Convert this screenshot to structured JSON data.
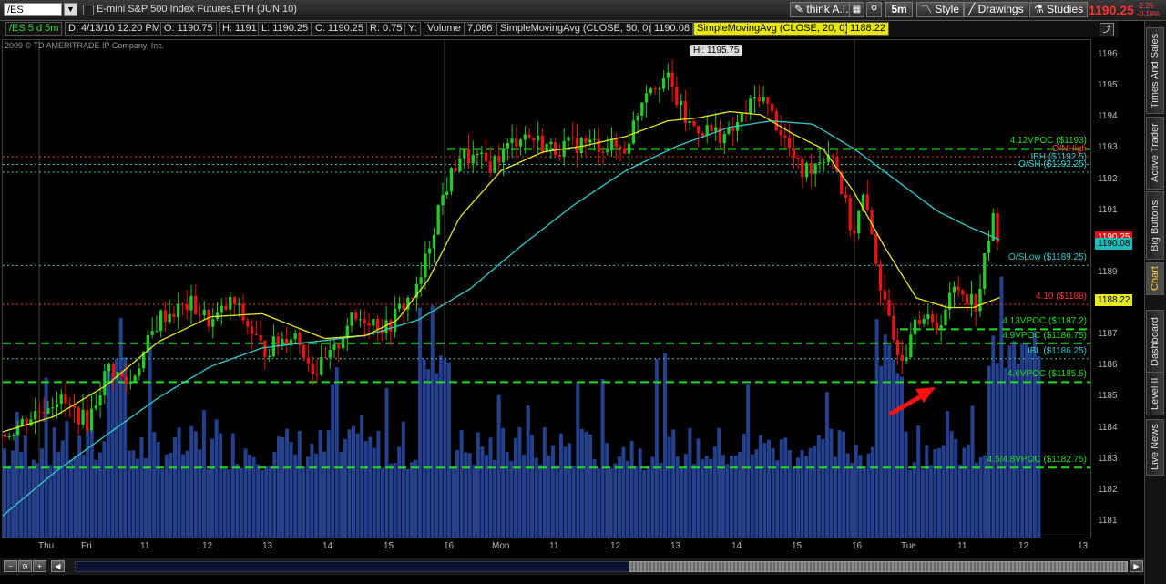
{
  "toolbar": {
    "symbol": "/ES",
    "description": "E-mini S&P 500 Index Futures,ETH (JUN 10)",
    "think_ai": "think A.I.",
    "timeframe": "5m",
    "style": "Style",
    "drawings": "Drawings",
    "studies": "Studies",
    "last_price": "1190.25",
    "change_abs": "-2.25",
    "change_pct": "-0.19%"
  },
  "infobar": {
    "title": "/ES 5 d 5m",
    "date": "D: 4/13/10 12:20 PM",
    "open": "O: 1190.75",
    "high": "H: 1191",
    "low": "L: 1190.25",
    "close": "C: 1190.25",
    "range": "R: 0.75",
    "y": "Y:",
    "volume_label": "Volume",
    "volume_value": "7,086",
    "sma50_label": "SimpleMovingAvg (CLOSE, 50, 0)",
    "sma50_value": "1190.08",
    "sma20_label": "SimpleMovingAvg (CLOSE, 20, 0)",
    "sma20_value": "1188.22"
  },
  "copyright": "2009 © TD AMERITRADE IP Company, Inc.",
  "chart_data": {
    "type": "candlestick",
    "title": "E-mini S&P 500 Index Futures,ETH (JUN 10)",
    "y_ticks": [
      "1196",
      "1195",
      "1194",
      "1193",
      "1192",
      "1191",
      "1190",
      "1189",
      "1188",
      "1187",
      "1186",
      "1185",
      "1184",
      "1183",
      "1182",
      "1181"
    ],
    "ylim": [
      1180.5,
      1196.5
    ],
    "x_ticks": [
      "Thu",
      "Fri",
      "11",
      "12",
      "13",
      "14",
      "15",
      "16",
      "Mon",
      "11",
      "12",
      "13",
      "14",
      "15",
      "16",
      "Tue",
      "11",
      "12",
      "13"
    ],
    "high_label": "Hi: 1195.75",
    "last_price_tag": "1190.25",
    "sma50_tag": "1190.08",
    "sma20_tag": "1188.22",
    "levels": [
      {
        "label": "4.12VPOC ($1193)",
        "price": 1193,
        "color": "#22dd22",
        "style": "dashed"
      },
      {
        "label": "O/NHigh",
        "price": 1192.75,
        "color": "#ff3333",
        "style": "dotted"
      },
      {
        "label": "IBH ($1192.5)",
        "price": 1192.5,
        "color": "#33cccc",
        "style": "dotted"
      },
      {
        "label": "O/SH ($1192.25)",
        "price": 1192.25,
        "color": "#33cccc",
        "style": "dotted"
      },
      {
        "label": "O/SLow ($1189.25)",
        "price": 1189.25,
        "color": "#33cccc",
        "style": "dotted"
      },
      {
        "label": "4.10 ($1188)",
        "price": 1188,
        "color": "#ff3333",
        "style": "dotted"
      },
      {
        "label": "4.13VPOC ($1187.2)",
        "price": 1187.2,
        "color": "#22dd22",
        "style": "dashed"
      },
      {
        "label": "4.9VPOC ($1186.75)",
        "price": 1186.75,
        "color": "#22dd22",
        "style": "dashed"
      },
      {
        "label": "IBL ($1186.25)",
        "price": 1186.25,
        "color": "#33cccc",
        "style": "dotted"
      },
      {
        "label": "4.6VPOC ($1185.5)",
        "price": 1185.5,
        "color": "#22dd22",
        "style": "dashed"
      },
      {
        "label": "4.5/4.8VPOC ($1182.75)",
        "price": 1182.75,
        "color": "#22dd22",
        "style": "dashed"
      }
    ],
    "price_path": [
      [
        0,
        1183.8
      ],
      [
        0.05,
        1185.0
      ],
      [
        0.08,
        1184.2
      ],
      [
        0.1,
        1186.0
      ],
      [
        0.12,
        1185.4
      ],
      [
        0.15,
        1187.6
      ],
      [
        0.18,
        1188.0
      ],
      [
        0.2,
        1187.4
      ],
      [
        0.22,
        1188.1
      ],
      [
        0.25,
        1186.5
      ],
      [
        0.28,
        1187.1
      ],
      [
        0.3,
        1185.8
      ],
      [
        0.32,
        1186.5
      ],
      [
        0.33,
        1187.4
      ],
      [
        0.35,
        1187.6
      ],
      [
        0.37,
        1187.2
      ],
      [
        0.38,
        1187.8
      ],
      [
        0.4,
        1188.5
      ],
      [
        0.42,
        1191.2
      ],
      [
        0.44,
        1192.8
      ],
      [
        0.47,
        1192.5
      ],
      [
        0.5,
        1193.5
      ],
      [
        0.53,
        1193.0
      ],
      [
        0.56,
        1193.2
      ],
      [
        0.6,
        1193.0
      ],
      [
        0.62,
        1195.0
      ],
      [
        0.64,
        1195.3
      ],
      [
        0.66,
        1193.8
      ],
      [
        0.7,
        1193.4
      ],
      [
        0.73,
        1194.8
      ],
      [
        0.75,
        1193.6
      ],
      [
        0.77,
        1192.2
      ],
      [
        0.8,
        1193.0
      ],
      [
        0.82,
        1190.2
      ],
      [
        0.83,
        1191.4
      ],
      [
        0.84,
        1190.0
      ],
      [
        0.85,
        1188.0
      ],
      [
        0.86,
        1186.8
      ],
      [
        0.87,
        1186.3
      ],
      [
        0.88,
        1187.8
      ],
      [
        0.9,
        1187.2
      ],
      [
        0.92,
        1188.6
      ],
      [
        0.94,
        1188.0
      ],
      [
        0.955,
        1190.8
      ],
      [
        0.96,
        1190.25
      ]
    ],
    "sma20_path": [
      [
        0,
        1183.9
      ],
      [
        0.05,
        1184.4
      ],
      [
        0.1,
        1185.4
      ],
      [
        0.15,
        1186.8
      ],
      [
        0.2,
        1187.6
      ],
      [
        0.25,
        1187.7
      ],
      [
        0.28,
        1187.3
      ],
      [
        0.31,
        1186.9
      ],
      [
        0.35,
        1187.0
      ],
      [
        0.38,
        1187.5
      ],
      [
        0.41,
        1188.8
      ],
      [
        0.44,
        1190.8
      ],
      [
        0.48,
        1192.3
      ],
      [
        0.52,
        1192.9
      ],
      [
        0.56,
        1193.1
      ],
      [
        0.6,
        1193.4
      ],
      [
        0.64,
        1193.9
      ],
      [
        0.67,
        1194.0
      ],
      [
        0.7,
        1194.2
      ],
      [
        0.73,
        1194.1
      ],
      [
        0.76,
        1193.5
      ],
      [
        0.79,
        1193.0
      ],
      [
        0.82,
        1191.6
      ],
      [
        0.85,
        1189.8
      ],
      [
        0.88,
        1188.2
      ],
      [
        0.91,
        1187.9
      ],
      [
        0.935,
        1187.9
      ],
      [
        0.96,
        1188.22
      ]
    ],
    "sma50_path": [
      [
        0,
        1181.2
      ],
      [
        0.05,
        1182.6
      ],
      [
        0.1,
        1183.8
      ],
      [
        0.15,
        1185.0
      ],
      [
        0.2,
        1186.0
      ],
      [
        0.25,
        1186.6
      ],
      [
        0.3,
        1186.8
      ],
      [
        0.35,
        1187.0
      ],
      [
        0.4,
        1187.5
      ],
      [
        0.45,
        1188.5
      ],
      [
        0.5,
        1189.9
      ],
      [
        0.55,
        1191.2
      ],
      [
        0.6,
        1192.3
      ],
      [
        0.65,
        1193.1
      ],
      [
        0.7,
        1193.7
      ],
      [
        0.74,
        1193.9
      ],
      [
        0.78,
        1193.8
      ],
      [
        0.82,
        1193.0
      ],
      [
        0.86,
        1192.0
      ],
      [
        0.9,
        1191.0
      ],
      [
        0.93,
        1190.5
      ],
      [
        0.96,
        1190.08
      ]
    ]
  },
  "sidebar": [
    "Times And Sales",
    "Active Trader",
    "Big Buttons",
    "Chart",
    "Dashboard",
    "Level II",
    "Live News"
  ],
  "colors": {
    "up": "#22cc22",
    "down": "#ee1111",
    "sma20": "#e8e820",
    "sma50": "#33cccc",
    "volume": "#24408e",
    "background": "#000000"
  }
}
